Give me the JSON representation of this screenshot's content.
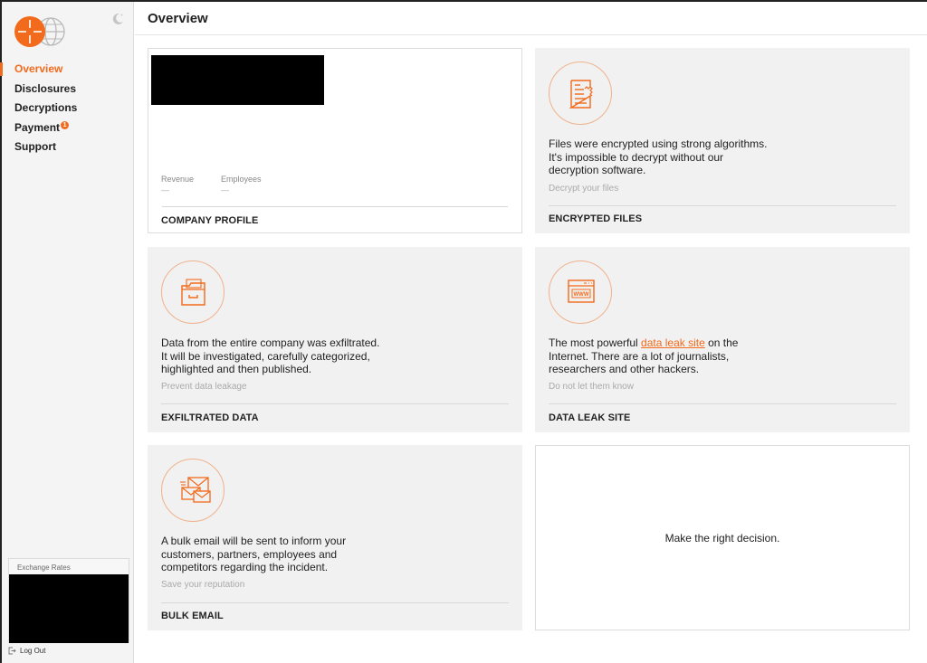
{
  "header": {
    "title": "Overview"
  },
  "sidebar": {
    "items": [
      {
        "label": "Overview",
        "active": true
      },
      {
        "label": "Disclosures"
      },
      {
        "label": "Decryptions"
      },
      {
        "label": "Payment",
        "badge": "1"
      },
      {
        "label": "Support"
      }
    ],
    "exchange_rates_label": "Exchange Rates",
    "logout_label": "Log Out"
  },
  "cards": {
    "company_profile": {
      "title": "COMPANY PROFILE",
      "revenue_label": "Revenue",
      "revenue_value": "—",
      "employees_label": "Employees",
      "employees_value": "—"
    },
    "encrypted_files": {
      "desc1": "Files were encrypted using strong algorithms.",
      "desc2": "It's impossible to decrypt without our",
      "desc3": "decryption software.",
      "sub": "Decrypt your files",
      "title": "ENCRYPTED FILES"
    },
    "exfiltrated_data": {
      "desc1": "Data from the entire company was exfiltrated.",
      "desc2": "It will be investigated, carefully categorized,",
      "desc3": "highlighted and then published.",
      "sub": "Prevent data leakage",
      "title": "EXFILTRATED DATA"
    },
    "data_leak_site": {
      "desc1_pre": "The most powerful ",
      "desc1_link": "data leak site",
      "desc1_post": " on the",
      "desc2": "Internet. There are a lot of journalists,",
      "desc3": "researchers and other hackers.",
      "sub": "Do not let them know",
      "title": "DATA LEAK SITE"
    },
    "bulk_email": {
      "desc1": "A bulk email will be sent to inform your",
      "desc2": "customers, partners, employees and",
      "desc3": "competitors regarding the incident.",
      "sub": "Save your reputation",
      "title": "BULK EMAIL"
    },
    "decision": {
      "text": "Make the right decision."
    }
  },
  "colors": {
    "accent": "#f26a1b",
    "card_bg": "#f1f1f1",
    "sidebar_bg": "#f4f4f4"
  },
  "icons": [
    "logo-icon",
    "globe-icon",
    "moon-icon",
    "document-icon",
    "folder-icon",
    "browser-www-icon",
    "mail-icon",
    "logout-icon"
  ]
}
